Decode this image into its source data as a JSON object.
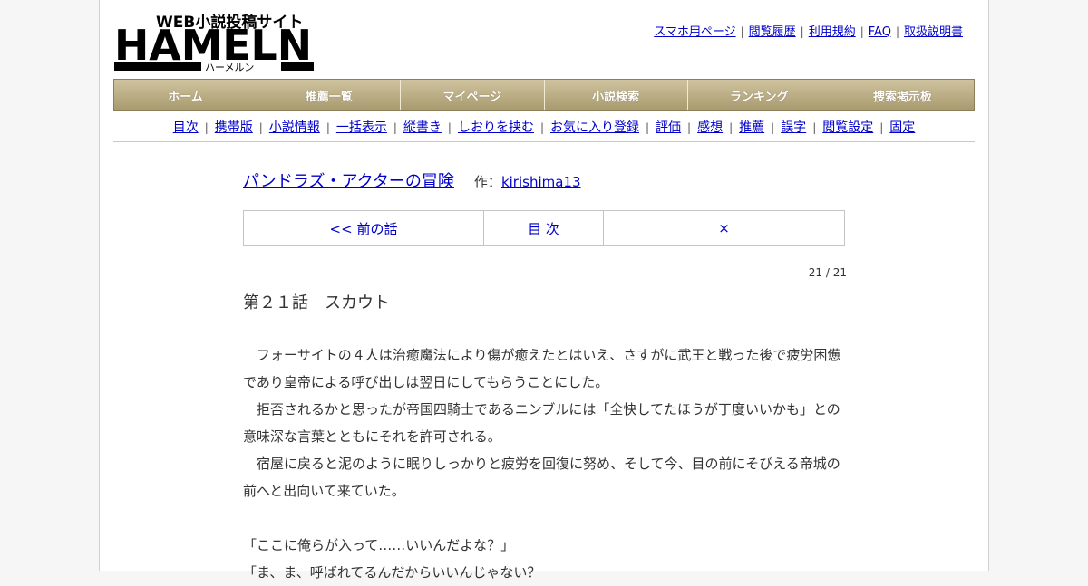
{
  "logo": {
    "line1": "WEB小説投稿サイト",
    "line2": "HAMELN",
    "line3": "ハーメルン"
  },
  "header_links": [
    "スマホ用ページ",
    "閲覧履歴",
    "利用規約",
    "FAQ",
    "取扱説明書"
  ],
  "global_nav": [
    "ホーム",
    "推薦一覧",
    "マイページ",
    "小説検索",
    "ランキング",
    "捜索掲示板"
  ],
  "sub_nav": [
    "目次",
    "携帯版",
    "小説情報",
    "一括表示",
    "縦書き",
    "しおりを挟む",
    "お気に入り登録",
    "評価",
    "感想",
    "推薦",
    "誤字",
    "閲覧設定",
    "固定"
  ],
  "novel": {
    "title": "パンドラズ・アクターの冒険",
    "author_prefix": "作：",
    "author": "kirishima13"
  },
  "pager": {
    "prev": "<< 前の話",
    "toc": "目 次",
    "close": "×"
  },
  "episode_counter": "21 / 21",
  "chapter_title": "第２１話　スカウト",
  "body_lines": [
    "　フォーサイトの４人は治癒魔法により傷が癒えたとはいえ、さすがに武王と戦った後で疲労困憊",
    "であり皇帝による呼び出しは翌日にしてもらうことにした。",
    "　拒否されるかと思ったが帝国四騎士であるニンブルには「全快してたほうが丁度いいかも」との",
    "意味深な言葉とともにそれを許可される。",
    "　宿屋に戻ると泥のように眠りしっかりと疲労を回復に努め、そして今、目の前にそびえる帝城の",
    "前へと出向いて来ていた。",
    "",
    "「ここに俺らが入って……いいんだよな？」",
    "「ま、ま、呼ばれてるんだからいいんじゃない？"
  ]
}
